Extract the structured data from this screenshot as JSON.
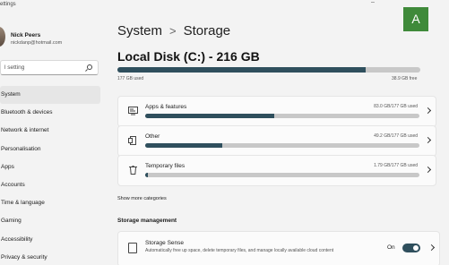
{
  "window": {
    "title": "ettings",
    "minimize_glyph": "–",
    "badge_letter": "A"
  },
  "user": {
    "name": "Nick Peers",
    "email": "nickdanp@hotmail.com"
  },
  "search": {
    "placeholder": "l setting"
  },
  "sidebar": {
    "items": [
      {
        "label": "System",
        "active": true
      },
      {
        "label": "Bluetooth & devices"
      },
      {
        "label": "Network & internet"
      },
      {
        "label": "Personalisation"
      },
      {
        "label": "Apps"
      },
      {
        "label": "Accounts"
      },
      {
        "label": "Time & language"
      },
      {
        "label": "Gaming"
      },
      {
        "label": "Accessibility"
      },
      {
        "label": "Privacy & security"
      }
    ]
  },
  "breadcrumb": {
    "parent": "System",
    "separator": ">",
    "current": "Storage"
  },
  "disk": {
    "title": "Local Disk (C:) - 216 GB",
    "used_label": "177 GB used",
    "free_label": "38.9 GB free",
    "used_fraction": 0.82
  },
  "categories": [
    {
      "label": "Apps & features",
      "size": "83.0 GB/177 GB used",
      "fraction": 0.47,
      "icon": "apps-icon"
    },
    {
      "label": "Other",
      "size": "49.2 GB/177 GB used",
      "fraction": 0.28,
      "icon": "document-icon"
    },
    {
      "label": "Temporary files",
      "size": "1.79 GB/177 GB used",
      "fraction": 0.01,
      "icon": "trash-icon"
    }
  ],
  "show_more": "Show more categories",
  "storage_management": {
    "heading": "Storage management",
    "sense_title": "Storage Sense",
    "sense_desc": "Automatically free up space, delete temporary files, and manage locally available cloud content",
    "sense_state": "On",
    "sense_on": true
  },
  "colors": {
    "accent": "#2f4f5d",
    "bar_track": "#c8c8c8",
    "badge": "#3f8a3a"
  }
}
